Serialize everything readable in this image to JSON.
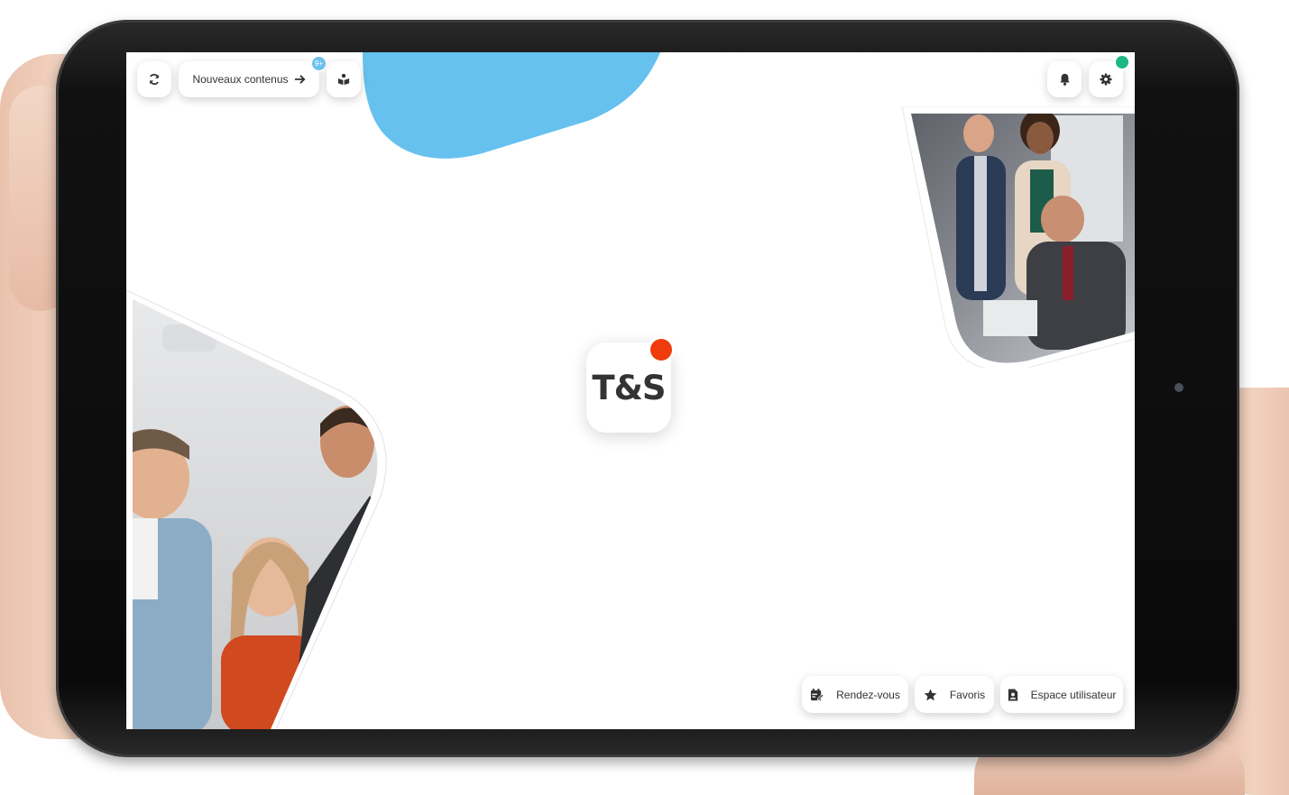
{
  "toolbar": {
    "refresh_icon": "refresh-icon",
    "new_content_label": "Nouveaux contenus",
    "new_content_badge": "9+",
    "reader_icon": "reader-icon",
    "notifications_icon": "bell-icon",
    "settings_icon": "gear-icon"
  },
  "logo": {
    "text": "T&S",
    "dot_color": "#f03c0c"
  },
  "bottom_nav": {
    "appointments_label": "Rendez-vous",
    "favorites_label": "Favoris",
    "user_space_label": "Espace utilisateur"
  },
  "colors": {
    "accent_blue": "#66c1ee",
    "status_online": "#1fb883"
  }
}
